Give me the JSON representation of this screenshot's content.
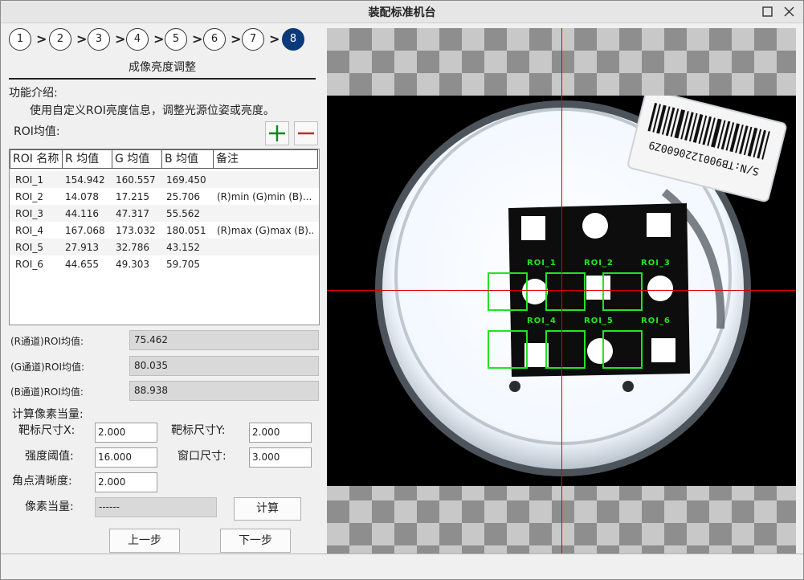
{
  "window": {
    "title": "装配标准机台"
  },
  "steps": [
    {
      "label": "1"
    },
    {
      "label": "2"
    },
    {
      "label": "3"
    },
    {
      "label": "4"
    },
    {
      "label": "5"
    },
    {
      "label": "6"
    },
    {
      "label": "7"
    },
    {
      "label": "8"
    }
  ],
  "active_step": "8",
  "section_title": "成像亮度调整",
  "intro": {
    "heading": "功能介绍:",
    "text": "使用自定义ROI亮度信息，调整光源位姿或亮度。"
  },
  "roi_avg_label": "ROI均值:",
  "table": {
    "headers": [
      "ROI 名称",
      "R 均值",
      "G 均值",
      "B 均值",
      "备注"
    ],
    "rows": [
      [
        "ROI_1",
        "154.942",
        "160.557",
        "169.450",
        ""
      ],
      [
        "ROI_2",
        "14.078",
        "17.215",
        "25.706",
        "(R)min (G)min (B)..."
      ],
      [
        "ROI_3",
        "44.116",
        "47.317",
        "55.562",
        ""
      ],
      [
        "ROI_4",
        "167.068",
        "173.032",
        "180.051",
        "(R)max (G)max (B)..."
      ],
      [
        "ROI_5",
        "27.913",
        "32.786",
        "43.152",
        ""
      ],
      [
        "ROI_6",
        "44.655",
        "49.303",
        "59.705",
        ""
      ]
    ]
  },
  "channels": [
    {
      "label": "(R通道)ROI均值:",
      "value": "75.462"
    },
    {
      "label": "(G通道)ROI均值:",
      "value": "80.035"
    },
    {
      "label": "(B通道)ROI均值:",
      "value": "88.938"
    }
  ],
  "calc": {
    "heading": "计算像素当量:",
    "target_x_label": "靶标尺寸X:",
    "target_x": "2.000",
    "target_y_label": "靶标尺寸Y:",
    "target_y": "2.000",
    "threshold_label": "强度阈值:",
    "threshold": "16.000",
    "window_label": "窗口尺寸:",
    "window_size": "3.000",
    "sharpness_label": "角点清晰度:",
    "sharpness": "2.000",
    "pixel_label": "像素当量:",
    "pixel_value": "------",
    "calc_button": "计算"
  },
  "nav": {
    "prev": "上一步",
    "next": "下一步"
  },
  "image": {
    "serial_text": "S/N:TB9001220600Z9",
    "roi_labels": [
      "ROI_1",
      "ROI_2",
      "ROI_3",
      "ROI_4",
      "ROI_5",
      "ROI_6"
    ]
  },
  "colors": {
    "roi": "#23e323",
    "crosshair": "#e10000",
    "active_step": "#0a3a7a",
    "add": "#0b8a16",
    "remove": "#c62828"
  },
  "icons": {
    "add": "plus-icon",
    "remove": "minus-icon",
    "maximize": "maximize-icon",
    "close": "close-icon",
    "arrow": "chevron-right-icon"
  }
}
